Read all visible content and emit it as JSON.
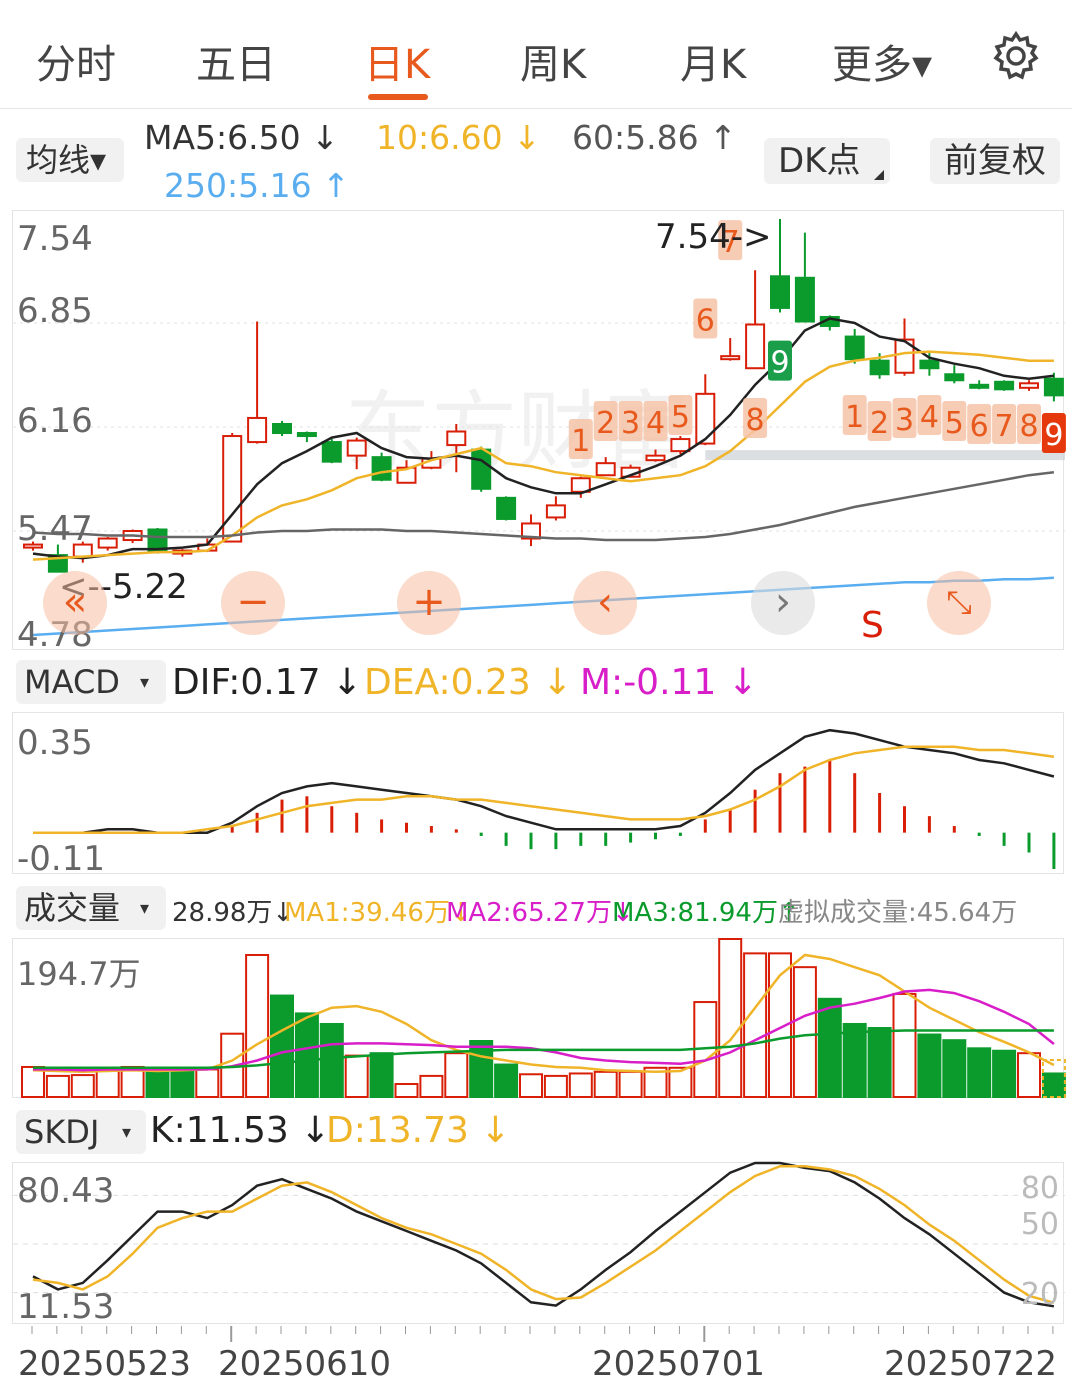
{
  "tabs": [
    "分时",
    "五日",
    "日K",
    "周K",
    "月K",
    "更多▾"
  ],
  "active_tab": "日K",
  "ma_row": {
    "selector": "均线▾",
    "ma5": "MA5:6.50 ↓",
    "ma10": "10:6.60 ↓",
    "ma60": "60:5.86 ↑",
    "ma250": "250:5.16 ↑",
    "dk_button": "DK点",
    "fq_button": "前复权"
  },
  "colors": {
    "accent": "#e8591d",
    "up": "#d81e06",
    "down": "#0a9b2c",
    "ma5": "#222222",
    "ma10": "#f0b429",
    "ma60": "#666666",
    "ma250": "#5aaef0",
    "pink": "#d81ec8"
  },
  "kline": {
    "axis_labels": [
      "7.54",
      "6.85",
      "6.16",
      "5.47",
      "4.78"
    ],
    "high_label": "7.54->",
    "low_label": "<--5.22",
    "signal": "S",
    "watermark": "东方财富",
    "seq_up": [
      "1",
      "2",
      "3",
      "4",
      "5",
      "6",
      "7",
      "8",
      "9"
    ],
    "seq_down": [
      "1",
      "2",
      "3",
      "4",
      "5",
      "6",
      "7",
      "8",
      "9"
    ]
  },
  "chart_data": [
    {
      "type": "candlestick",
      "title": "日K",
      "ylim": [
        4.78,
        7.54
      ],
      "candles": [
        [
          5.36,
          5.38,
          5.4,
          5.34
        ],
        [
          5.31,
          5.2,
          5.38,
          5.2
        ],
        [
          5.3,
          5.38,
          5.4,
          5.26
        ],
        [
          5.36,
          5.42,
          5.43,
          5.34
        ],
        [
          5.41,
          5.47,
          5.48,
          5.39
        ],
        [
          5.48,
          5.34,
          5.49,
          5.32
        ],
        [
          5.32,
          5.34,
          5.35,
          5.3
        ],
        [
          5.34,
          5.38,
          5.42,
          5.33
        ],
        [
          5.4,
          6.1,
          6.12,
          5.4
        ],
        [
          6.06,
          6.22,
          6.86,
          6.05
        ],
        [
          6.18,
          6.12,
          6.2,
          6.1
        ],
        [
          6.12,
          6.11,
          6.13,
          6.06
        ],
        [
          6.06,
          5.93,
          6.08,
          5.92
        ],
        [
          5.97,
          6.07,
          6.09,
          5.88
        ],
        [
          5.96,
          5.81,
          5.99,
          5.8
        ],
        [
          5.79,
          5.89,
          5.94,
          5.79
        ],
        [
          5.89,
          5.95,
          6.0,
          5.88
        ],
        [
          6.04,
          6.13,
          6.18,
          5.86
        ],
        [
          6.01,
          5.75,
          6.03,
          5.73
        ],
        [
          5.69,
          5.55,
          5.7,
          5.54
        ],
        [
          5.42,
          5.52,
          5.58,
          5.37
        ],
        [
          5.56,
          5.64,
          5.7,
          5.54
        ],
        [
          5.73,
          5.82,
          5.83,
          5.69
        ],
        [
          5.84,
          5.92,
          5.96,
          5.84
        ],
        [
          5.83,
          5.89,
          5.91,
          5.83
        ],
        [
          5.94,
          5.97,
          6.01,
          5.93
        ],
        [
          6.0,
          6.08,
          6.1,
          5.98
        ],
        [
          6.05,
          6.38,
          6.51,
          6.04
        ],
        [
          6.61,
          6.63,
          6.75,
          6.6
        ],
        [
          6.55,
          6.84,
          7.2,
          6.55
        ],
        [
          7.16,
          6.95,
          7.54,
          6.92
        ],
        [
          7.15,
          6.86,
          7.45,
          6.86
        ],
        [
          6.89,
          6.83,
          6.9,
          6.8
        ],
        [
          6.76,
          6.61,
          6.81,
          6.58
        ],
        [
          6.6,
          6.51,
          6.65,
          6.48
        ],
        [
          6.52,
          6.74,
          6.88,
          6.5
        ],
        [
          6.6,
          6.55,
          6.65,
          6.5
        ],
        [
          6.51,
          6.47,
          6.57,
          6.45
        ],
        [
          6.44,
          6.43,
          6.47,
          6.41
        ],
        [
          6.46,
          6.41,
          6.47,
          6.4
        ],
        [
          6.42,
          6.45,
          6.47,
          6.4
        ],
        [
          6.48,
          6.37,
          6.52,
          6.33
        ]
      ],
      "series": [
        {
          "name": "MA5",
          "values": [
            5.32,
            5.3,
            5.29,
            5.31,
            5.35,
            5.35,
            5.36,
            5.38,
            5.58,
            5.78,
            5.92,
            6.0,
            6.09,
            6.12,
            6.02,
            5.96,
            5.95,
            5.97,
            5.94,
            5.82,
            5.76,
            5.72,
            5.72,
            5.78,
            5.84,
            5.9,
            5.97,
            6.08,
            6.24,
            6.44,
            6.6,
            6.8,
            6.88,
            6.85,
            6.76,
            6.73,
            6.62,
            6.58,
            6.55,
            6.5,
            6.48,
            6.5
          ]
        },
        {
          "name": "10",
          "values": [
            5.28,
            5.29,
            5.3,
            5.31,
            5.32,
            5.33,
            5.33,
            5.34,
            5.44,
            5.56,
            5.64,
            5.68,
            5.74,
            5.82,
            5.86,
            5.88,
            5.94,
            5.98,
            6.02,
            5.92,
            5.9,
            5.86,
            5.84,
            5.82,
            5.8,
            5.82,
            5.84,
            5.9,
            6.0,
            6.14,
            6.3,
            6.46,
            6.56,
            6.6,
            6.62,
            6.65,
            6.66,
            6.65,
            6.64,
            6.62,
            6.6,
            6.6
          ]
        },
        {
          "name": "60",
          "values": [
            5.46,
            5.45,
            5.45,
            5.44,
            5.44,
            5.43,
            5.43,
            5.43,
            5.44,
            5.46,
            5.47,
            5.47,
            5.48,
            5.48,
            5.48,
            5.47,
            5.47,
            5.46,
            5.45,
            5.44,
            5.43,
            5.42,
            5.42,
            5.41,
            5.41,
            5.41,
            5.42,
            5.43,
            5.45,
            5.48,
            5.51,
            5.55,
            5.59,
            5.63,
            5.66,
            5.69,
            5.72,
            5.75,
            5.78,
            5.81,
            5.84,
            5.86
          ]
        },
        {
          "name": "250",
          "values": [
            4.78,
            4.79,
            4.8,
            4.81,
            4.82,
            4.83,
            4.84,
            4.85,
            4.86,
            4.87,
            4.88,
            4.89,
            4.9,
            4.91,
            4.92,
            4.93,
            4.94,
            4.95,
            4.96,
            4.97,
            4.98,
            4.99,
            5.0,
            5.01,
            5.02,
            5.03,
            5.04,
            5.05,
            5.06,
            5.07,
            5.08,
            5.09,
            5.1,
            5.11,
            5.12,
            5.13,
            5.13,
            5.14,
            5.14,
            5.15,
            5.15,
            5.16
          ]
        }
      ]
    },
    {
      "type": "bar",
      "title": "MACD",
      "ylim": [
        -0.11,
        0.35
      ],
      "values": [
        0,
        0,
        0,
        0,
        0,
        0,
        0,
        0,
        0.02,
        0.06,
        0.1,
        0.11,
        0.08,
        0.06,
        0.04,
        0.03,
        0.02,
        0.01,
        -0.01,
        -0.04,
        -0.05,
        -0.05,
        -0.04,
        -0.04,
        -0.03,
        -0.02,
        -0.01,
        0.04,
        0.07,
        0.13,
        0.18,
        0.2,
        0.22,
        0.18,
        0.12,
        0.08,
        0.05,
        0.02,
        -0.01,
        -0.04,
        -0.06,
        -0.11
      ],
      "series": [
        {
          "name": "DIF",
          "values": [
            0,
            0,
            0,
            0.01,
            0.01,
            0,
            0,
            0,
            0.03,
            0.08,
            0.12,
            0.14,
            0.15,
            0.14,
            0.13,
            0.12,
            0.11,
            0.1,
            0.08,
            0.05,
            0.03,
            0.01,
            0.01,
            0.01,
            0.01,
            0.01,
            0.02,
            0.06,
            0.12,
            0.19,
            0.24,
            0.29,
            0.31,
            0.3,
            0.28,
            0.26,
            0.25,
            0.24,
            0.22,
            0.21,
            0.19,
            0.17
          ]
        },
        {
          "name": "DEA",
          "values": [
            0,
            0,
            0,
            0,
            0,
            0,
            0,
            0.01,
            0.02,
            0.04,
            0.06,
            0.08,
            0.09,
            0.1,
            0.1,
            0.11,
            0.11,
            0.1,
            0.1,
            0.09,
            0.08,
            0.07,
            0.06,
            0.05,
            0.04,
            0.04,
            0.04,
            0.05,
            0.07,
            0.1,
            0.14,
            0.19,
            0.22,
            0.24,
            0.25,
            0.26,
            0.26,
            0.26,
            0.25,
            0.25,
            0.24,
            0.23
          ]
        }
      ]
    },
    {
      "type": "bar",
      "title": "成交量",
      "ylim": [
        0,
        194.7
      ],
      "values": [
        37,
        26,
        27,
        36,
        37,
        35,
        34,
        34,
        78,
        175,
        125,
        103,
        90,
        51,
        54,
        16,
        26,
        54,
        69,
        40,
        28,
        26,
        29,
        31,
        31,
        36,
        36,
        117,
        194.7,
        177,
        177,
        160,
        121,
        90,
        85,
        127,
        77,
        70,
        60,
        57,
        54,
        29
      ],
      "up": [
        true,
        true,
        true,
        true,
        true,
        false,
        false,
        true,
        true,
        true,
        false,
        false,
        false,
        true,
        false,
        true,
        true,
        true,
        false,
        false,
        true,
        true,
        true,
        true,
        true,
        true,
        true,
        true,
        true,
        true,
        true,
        true,
        false,
        false,
        false,
        true,
        false,
        false,
        false,
        false,
        true,
        false
      ],
      "series": [
        {
          "name": "MA1",
          "values": [
            33,
            32,
            31,
            32,
            33,
            32,
            33,
            34,
            45,
            65,
            82,
            98,
            110,
            112,
            105,
            90,
            70,
            58,
            50,
            45,
            40,
            37,
            36,
            33,
            32,
            31,
            32,
            45,
            70,
            110,
            150,
            175,
            170,
            160,
            150,
            130,
            110,
            95,
            80,
            68,
            55,
            39.46
          ]
        },
        {
          "name": "MA2",
          "values": [
            34,
            34,
            33,
            34,
            34,
            34,
            34,
            34,
            38,
            45,
            55,
            60,
            65,
            66,
            66,
            65,
            64,
            62,
            62,
            62,
            60,
            55,
            48,
            45,
            43,
            42,
            41,
            45,
            55,
            70,
            85,
            100,
            110,
            115,
            122,
            130,
            132,
            128,
            118,
            105,
            90,
            65.27
          ]
        },
        {
          "name": "MA3",
          "values": [
            36,
            36,
            36,
            36,
            36,
            36,
            36,
            36,
            37,
            39,
            42,
            45,
            48,
            50,
            52,
            54,
            55,
            56,
            57,
            58,
            58,
            58,
            58,
            58,
            58,
            58,
            58,
            60,
            62,
            66,
            72,
            76,
            78,
            80,
            81,
            82,
            82,
            82,
            82,
            82,
            82,
            81.94
          ]
        }
      ]
    },
    {
      "type": "line",
      "title": "SKDJ",
      "ylim": [
        11.53,
        100
      ],
      "series": [
        {
          "name": "K",
          "values": [
            30,
            22,
            26,
            40,
            55,
            70,
            70,
            66,
            74,
            86,
            90,
            84,
            78,
            70,
            64,
            58,
            52,
            46,
            38,
            26,
            14,
            12,
            22,
            34,
            45,
            58,
            70,
            82,
            94,
            100,
            100,
            97,
            95,
            88,
            78,
            66,
            56,
            44,
            32,
            20,
            14,
            11.53
          ]
        },
        {
          "name": "D",
          "values": [
            28,
            26,
            22,
            30,
            44,
            60,
            66,
            70,
            70,
            78,
            86,
            88,
            82,
            74,
            66,
            60,
            56,
            50,
            44,
            34,
            22,
            16,
            17,
            26,
            36,
            46,
            58,
            70,
            82,
            92,
            98,
            98,
            96,
            92,
            84,
            74,
            62,
            52,
            40,
            28,
            18,
            13.73
          ]
        }
      ]
    }
  ],
  "macd_row": {
    "selector": "MACD",
    "dif": "DIF:0.17 ↓",
    "dea": "DEA:0.23 ↓",
    "m": "M:-0.11 ↓"
  },
  "macd_axis": [
    "0.35",
    "-0.11"
  ],
  "vol_row": {
    "selector": "成交量",
    "vol": "28.98万↓",
    "ma1": "MA1:39.46万↓",
    "ma2": "MA2:65.27万↓",
    "ma3": "MA3:81.94万↑",
    "virtual": "虚拟成交量:45.64万"
  },
  "vol_axis": [
    "194.7万"
  ],
  "skdj_row": {
    "selector": "SKDJ",
    "k": "K:11.53 ↓",
    "d": "D:13.73 ↓"
  },
  "skdj_axis": {
    "left": [
      "80.43",
      "11.53"
    ],
    "right": [
      "80",
      "50",
      "20"
    ]
  },
  "dates": [
    "20250523",
    "20250610",
    "20250701",
    "20250722"
  ]
}
